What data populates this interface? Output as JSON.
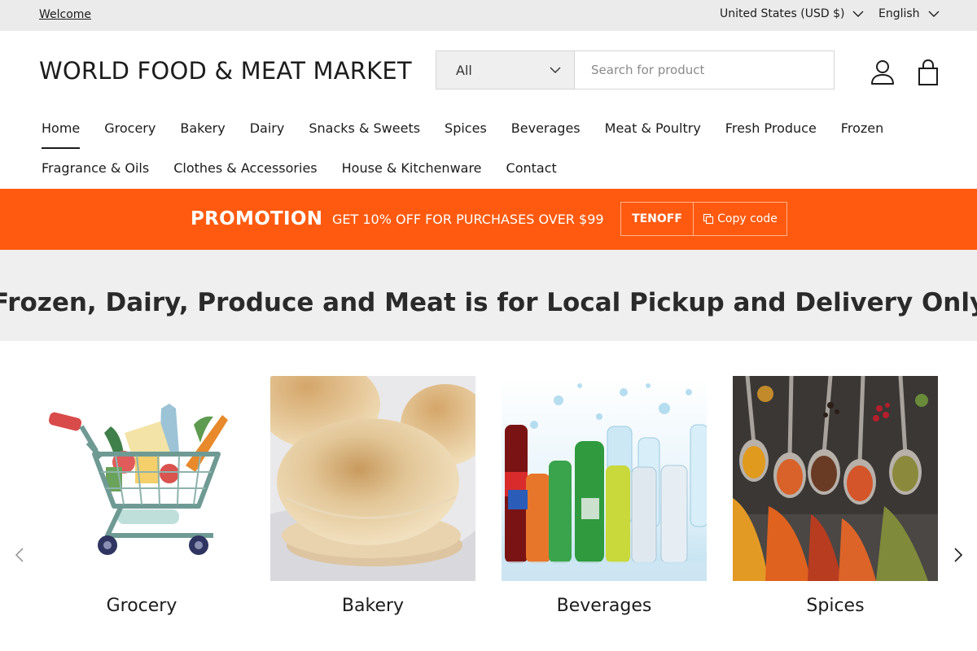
{
  "topbar": {
    "welcome": "Welcome",
    "currency": "United States (USD $)",
    "language": "English"
  },
  "header": {
    "logo": "WORLD FOOD & MEAT MARKET",
    "search_category": "All",
    "search_placeholder": "Search for product"
  },
  "nav": {
    "row1": [
      "Home",
      "Grocery",
      "Bakery",
      "Dairy",
      "Snacks & Sweets",
      "Spices",
      "Beverages",
      "Meat & Poultry",
      "Fresh Produce",
      "Frozen"
    ],
    "row2": [
      "Fragrance & Oils",
      "Clothes & Accessories",
      "House & Kitchenware",
      "Contact"
    ],
    "active": "Home"
  },
  "promo": {
    "title": "PROMOTION",
    "description": "GET 10% OFF FOR PURCHASES OVER $99",
    "code": "TENOFF",
    "copy_label": "Copy code",
    "color": "#ff5a0f"
  },
  "marquee": {
    "message": "Frozen, Dairy, Produce and Meat is for Local Pickup and Delivery Only",
    "next_fragment": "F"
  },
  "categories": [
    {
      "label": "Grocery",
      "icon": "shopping-cart-illustration"
    },
    {
      "label": "Bakery",
      "icon": "pita-bread-photo"
    },
    {
      "label": "Beverages",
      "icon": "bottled-drinks-photo"
    },
    {
      "label": "Spices",
      "icon": "spice-spoons-photo"
    }
  ]
}
